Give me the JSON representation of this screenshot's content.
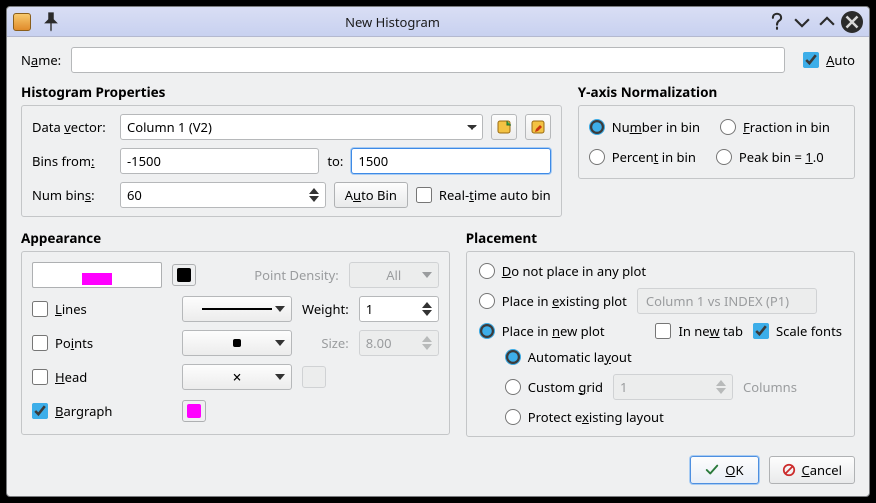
{
  "window": {
    "title": "New Histogram"
  },
  "name_row": {
    "label_pre": "N",
    "label_u": "a",
    "label_post": "me:",
    "value": "",
    "auto_u": "A",
    "auto_post": "uto",
    "auto_checked": true
  },
  "hist": {
    "title": "Histogram Properties",
    "data_vector_lbl_pre": "Data ",
    "data_vector_lbl_u": "v",
    "data_vector_lbl_post": "ector:",
    "data_vector_value": "Column 1 (V2)",
    "bins_from_lbl_pre": "Bins from",
    "bins_from_lbl_u": ":",
    "bins_from_value": "-1500",
    "to_lbl": "to:",
    "to_value": "1500",
    "num_bins_lbl_pre": "Num bin",
    "num_bins_lbl_u": "s",
    "num_bins_lbl_post": ":",
    "num_bins_value": "60",
    "autobin_btn_pre": "A",
    "autobin_btn_u": "u",
    "autobin_btn_post": "to Bin",
    "realtime_lbl_pre": "Real-",
    "realtime_lbl_u": "t",
    "realtime_lbl_post": "ime auto bin",
    "realtime_checked": false
  },
  "yaxis": {
    "title": "Y-axis Normalization",
    "number_lbl_pre": "Nu",
    "number_lbl_u": "m",
    "number_lbl_post": "ber in bin",
    "fraction_lbl_pre": "",
    "fraction_lbl_u": "F",
    "fraction_lbl_post": "raction in bin",
    "percent_lbl_pre": "Percen",
    "percent_lbl_u": "t",
    "percent_lbl_post": " in bin",
    "peak_lbl_pre": "Peak bin = ",
    "peak_lbl_u": "1",
    "peak_lbl_post": ".0",
    "selected": "number"
  },
  "appearance": {
    "title": "Appearance",
    "swatch_color": "#ff00ff",
    "stroke_color": "#000000",
    "point_density_lbl": "Point Density:",
    "point_density_value": "All",
    "lines_lbl_pre": "",
    "lines_lbl_u": "L",
    "lines_lbl_post": "ines",
    "lines_checked": false,
    "weight_lbl": "Weight:",
    "weight_value": "1",
    "points_lbl_pre": "Po",
    "points_lbl_u": "i",
    "points_lbl_post": "nts",
    "points_checked": false,
    "size_lbl": "Size:",
    "size_value": "8.00",
    "head_lbl_pre": "",
    "head_lbl_u": "H",
    "head_lbl_post": "ead",
    "head_checked": false,
    "bargraph_lbl_pre": "",
    "bargraph_lbl_u": "B",
    "bargraph_lbl_post": "argraph",
    "bargraph_checked": true,
    "bargraph_color": "#ff00ff"
  },
  "placement": {
    "title": "Placement",
    "donot_pre": "",
    "donot_u": "D",
    "donot_post": "o not place in any plot",
    "existing_pre": "Place in ",
    "existing_u": "e",
    "existing_post": "xisting plot",
    "existing_value": "Column 1 vs INDEX (P1)",
    "newplot_pre": "Place in ",
    "newplot_u": "n",
    "newplot_post": "ew plot",
    "newtab_pre": "In ne",
    "newtab_u": "w",
    "newtab_post": " tab",
    "newtab_checked": false,
    "scalefonts_lbl": "Scale fonts",
    "scalefonts_checked": true,
    "auto_layout_lbl": "Automatic la",
    "auto_layout_u": "y",
    "auto_layout_post": "out",
    "custom_grid_pre": "Custom ",
    "custom_grid_u": "g",
    "custom_grid_post": "rid",
    "custom_grid_value": "1",
    "columns_lbl": "Columns",
    "protect_pre": "Protect e",
    "protect_u": "x",
    "protect_post": "isting layout",
    "selected": "new",
    "layout_selected": "auto"
  },
  "buttons": {
    "ok_pre": "",
    "ok_u": "O",
    "ok_post": "K",
    "cancel_pre": "",
    "cancel_u": "C",
    "cancel_post": "ancel"
  }
}
